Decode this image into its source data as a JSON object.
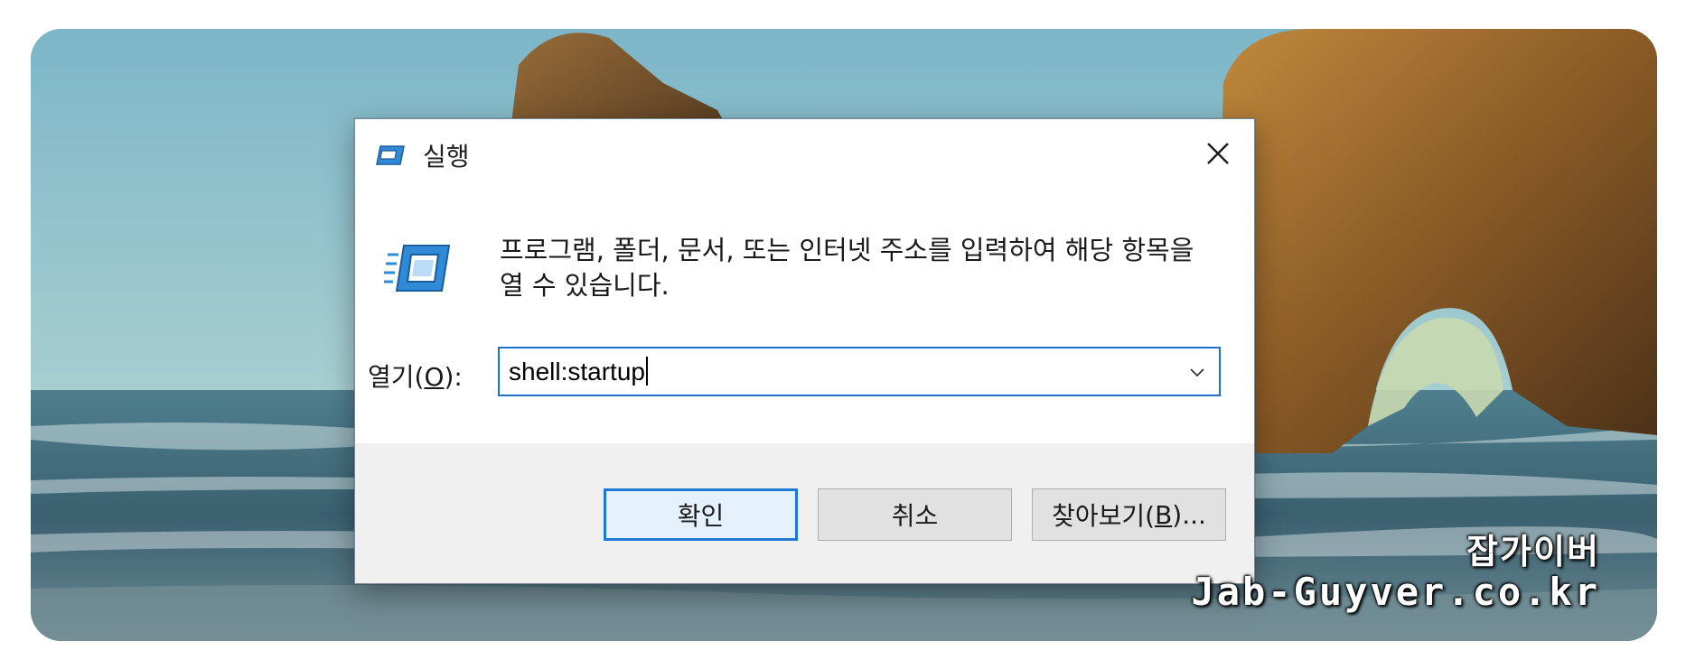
{
  "dialog": {
    "title": "실행",
    "icon": "run-icon",
    "description": "프로그램, 폴더, 문서, 또는 인터넷 주소를 입력하여 해당 항목을 열 수 있습니다.",
    "open_label_prefix": "열기(",
    "open_label_mnemonic": "O",
    "open_label_suffix": "):",
    "open_value": "shell:startup",
    "buttons": {
      "ok": "확인",
      "cancel": "취소",
      "browse_prefix": "찾아보기(",
      "browse_mnemonic": "B",
      "browse_suffix": ")..."
    }
  },
  "watermark": {
    "line1": "잡가이버",
    "line2": "Jab-Guyver.co.kr"
  },
  "colors": {
    "accent": "#1e78d6",
    "footer": "#f0f0f0",
    "button": "#e1e1e1"
  }
}
